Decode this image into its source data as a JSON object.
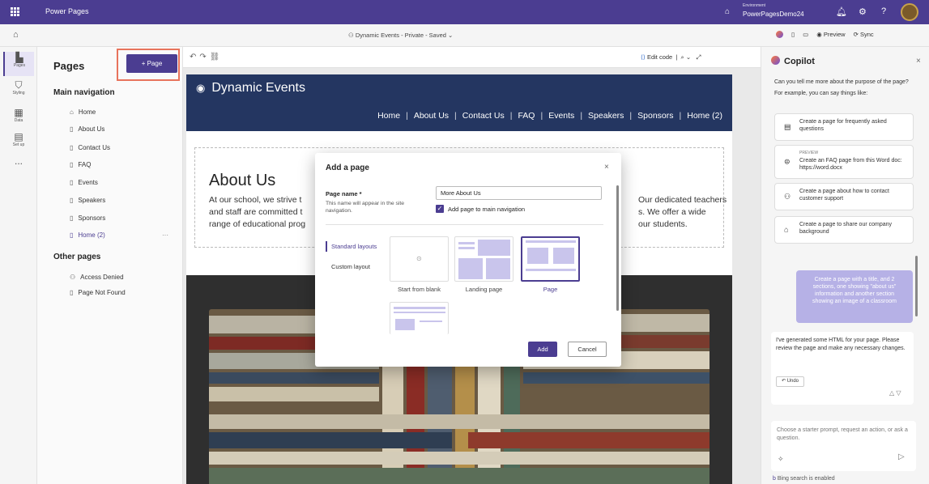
{
  "topbar": {
    "app_name": "Power Pages",
    "environment_label": "Environment",
    "environment_name": "PowerPagesDemo24"
  },
  "cmdbar": {
    "site_status": "Dynamic Events - Private - Saved",
    "preview": "Preview",
    "sync": "Sync"
  },
  "rail": {
    "pages": "Pages",
    "styling": "Styling",
    "data": "Data",
    "setup": "Set up",
    "more": "..."
  },
  "pages": {
    "title": "Pages",
    "add_button": "+ Page",
    "main_nav_heading": "Main navigation",
    "main_nav": [
      "Home",
      "About Us",
      "Contact Us",
      "FAQ",
      "Events",
      "Speakers",
      "Sponsors",
      "Home (2)"
    ],
    "other_heading": "Other pages",
    "other": [
      "Access Denied",
      "Page Not Found"
    ],
    "more": "···"
  },
  "canvas": {
    "edit_code": "Edit code"
  },
  "site": {
    "brand": "Dynamic Events",
    "nav": [
      "Home",
      "About Us",
      "Contact Us",
      "FAQ",
      "Events",
      "Speakers",
      "Sponsors",
      "Home (2)"
    ],
    "about_heading": "About Us",
    "para_line1": "At our school, we strive t",
    "para_line1_end": "Our dedicated teachers",
    "para_line2": "and staff are committed t",
    "para_line2_end": "s. We offer a wide",
    "para_line3": "range of educational prog",
    "para_line3_end": "our students."
  },
  "modal": {
    "title": "Add a page",
    "close": "×",
    "name_label": "Page name *",
    "name_hint": "This name will appear in the site navigation.",
    "name_value": "More About Us",
    "add_to_nav": "Add page to main navigation",
    "tab_standard": "Standard layouts",
    "tab_custom": "Custom layout",
    "layouts": [
      "Start from blank",
      "Landing page",
      "Page"
    ],
    "add": "Add",
    "cancel": "Cancel"
  },
  "copilot": {
    "title": "Copilot",
    "intro": "Can you tell me more about the purpose of the page?",
    "example": "For example, you can say things like:",
    "prompts": [
      {
        "text": "Create a page for frequently asked questions",
        "badge": ""
      },
      {
        "text": "Create an FAQ page from this Word doc: https://word.docx",
        "badge": "PREVIEW"
      },
      {
        "text": "Create a page about how to contact customer support",
        "badge": ""
      },
      {
        "text": "Create a page to share our company background",
        "badge": ""
      }
    ],
    "user_msg": "Create a page with a title, and 2 sections, one showing \"about us\" information and another section showing an image of a classroom",
    "response": "I've generated some HTML for your page. Please review the page and make any necessary changes.",
    "undo": "Undo",
    "input_placeholder": "Choose a starter prompt, request an action, or ask a question.",
    "bing": "Bing search is enabled"
  },
  "colors": {
    "brand": "#4b3d91",
    "site_header": "#243661",
    "highlight": "#e8735c"
  }
}
